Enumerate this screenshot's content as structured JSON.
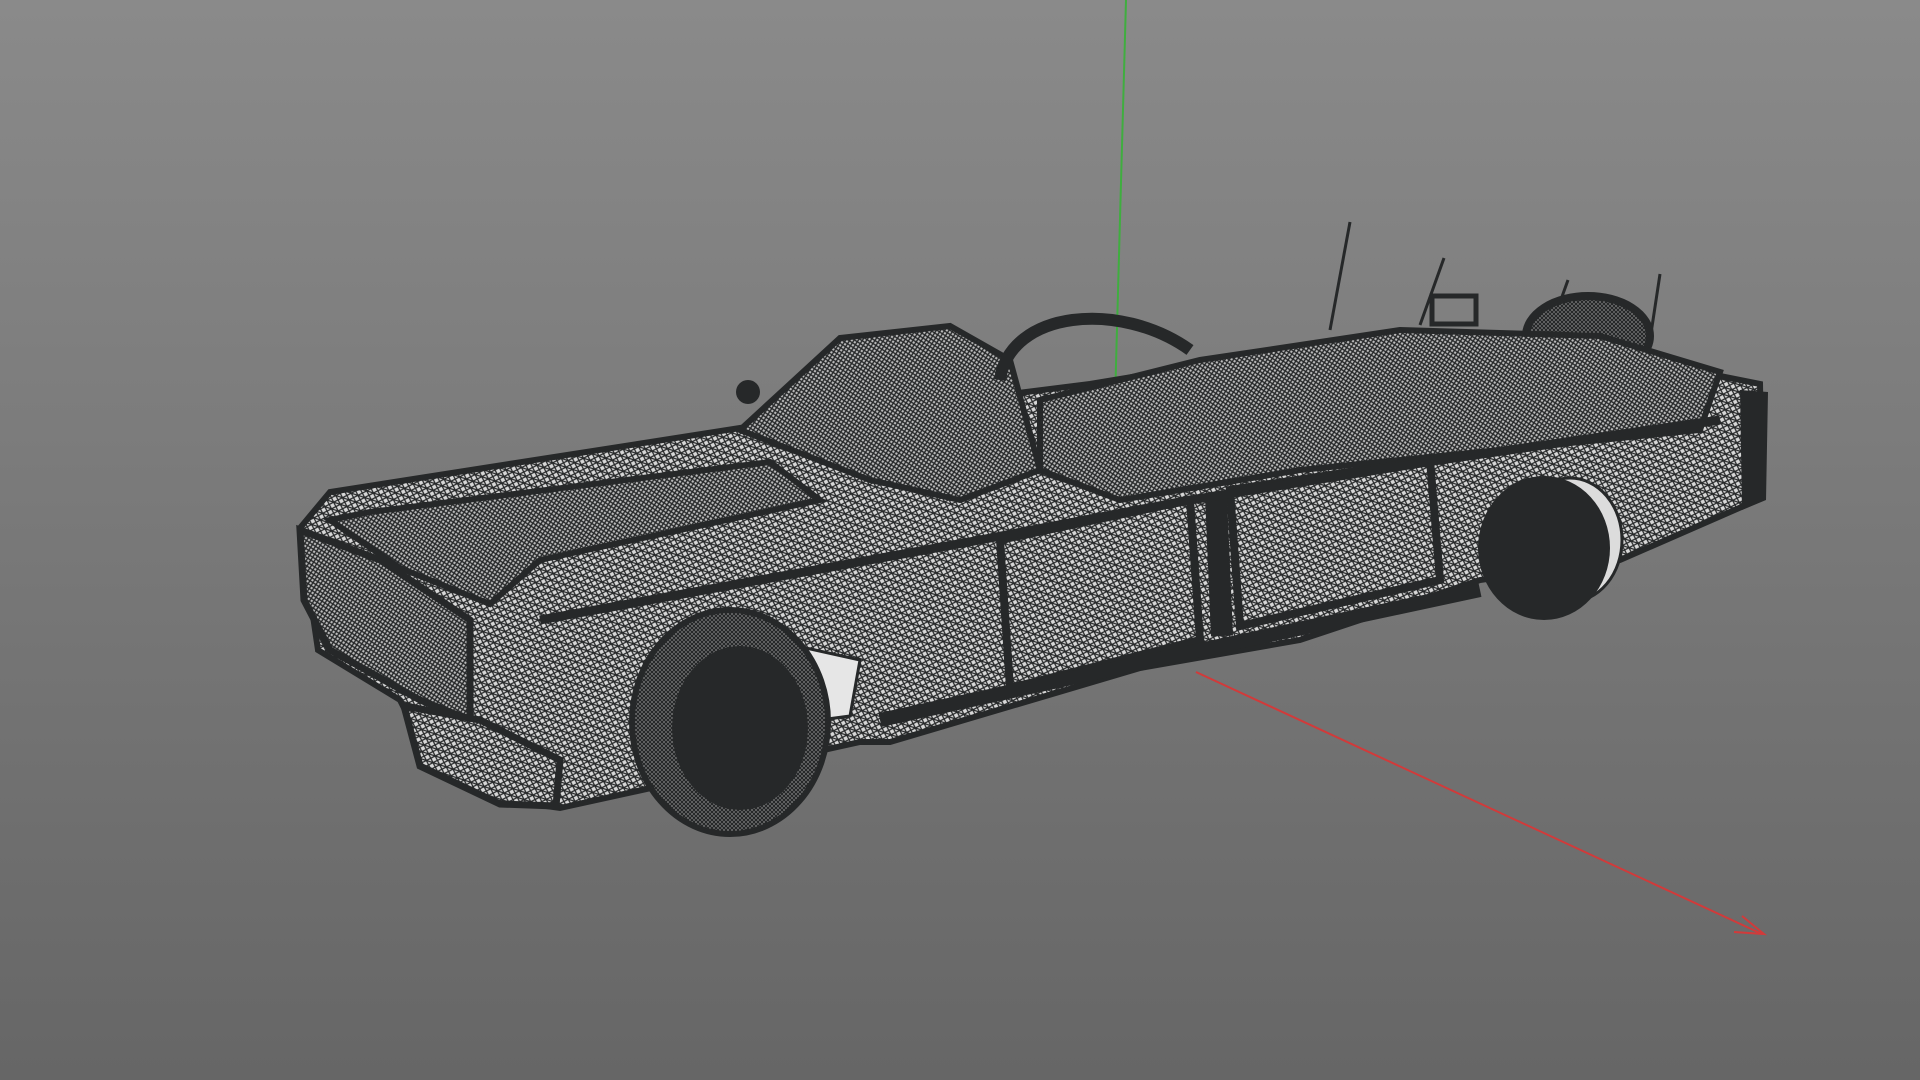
{
  "viewport": {
    "background_top": "#8a8a8a",
    "background_bottom": "#666666"
  },
  "axes": {
    "x_axis_color": "#d23a3a",
    "y_axis_color": "#3fae3f"
  },
  "model": {
    "render_mode": "wireframe",
    "mesh_color": "#262829",
    "face_color": "#dcdcdc"
  }
}
